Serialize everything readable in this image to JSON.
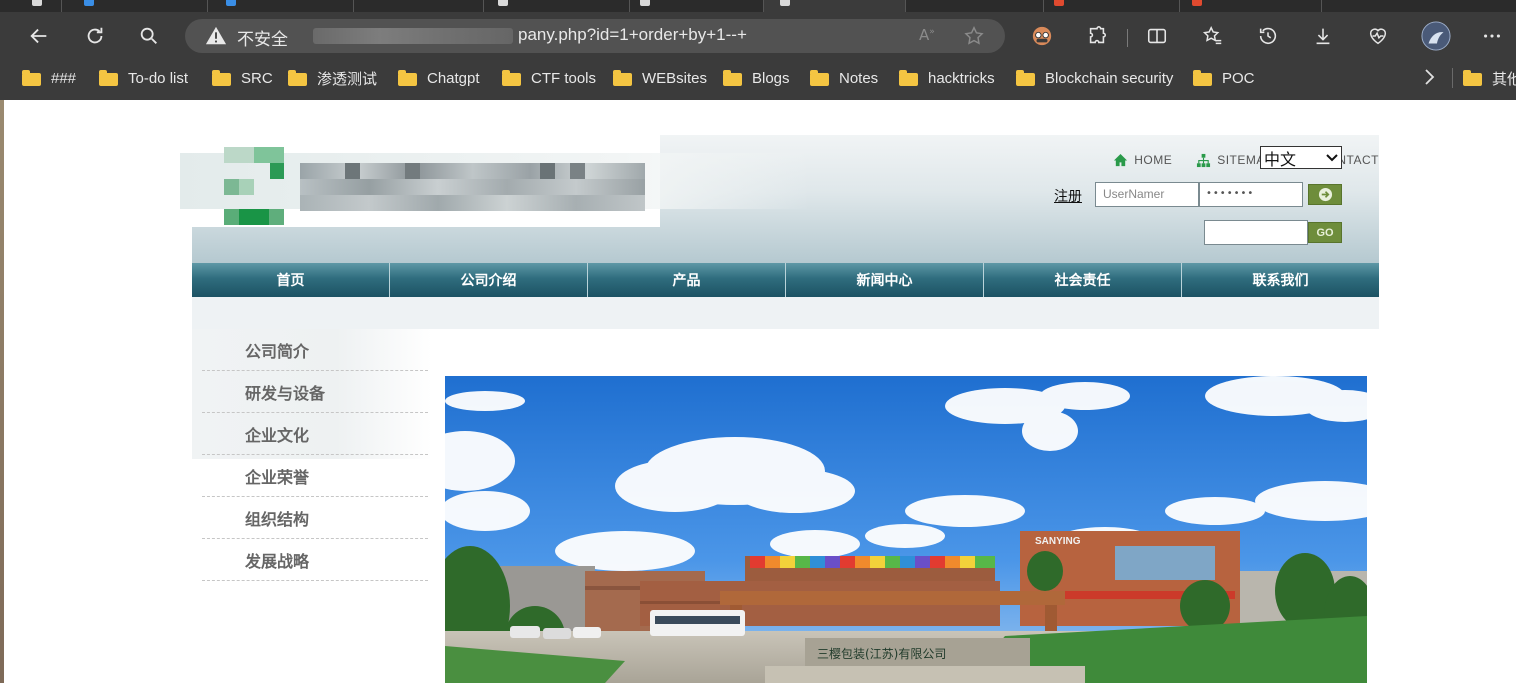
{
  "browser": {
    "address": {
      "security_label": "不安全",
      "url_visible": "pany.php?id=1+order+by+1--+"
    },
    "bookmarks": [
      {
        "label": "###"
      },
      {
        "label": "To-do list"
      },
      {
        "label": "SRC"
      },
      {
        "label": "渗透测试"
      },
      {
        "label": "Chatgpt"
      },
      {
        "label": "CTF tools"
      },
      {
        "label": "WEBsites"
      },
      {
        "label": "Blogs"
      },
      {
        "label": "Notes"
      },
      {
        "label": "hacktricks"
      },
      {
        "label": "Blockchain security"
      },
      {
        "label": "POC"
      },
      {
        "label": "其他"
      }
    ]
  },
  "site": {
    "toplinks": {
      "home": "HOME",
      "sitemap": "SITEMAP",
      "contact": "CONTACT"
    },
    "language": "中文",
    "register": "注册",
    "username_placeholder": "UserNamer",
    "password_mask": "•••••••",
    "go_label": "GO",
    "nav": [
      "首页",
      "公司介绍",
      "产品",
      "新闻中心",
      "社会责任",
      "联系我们"
    ],
    "sidebar": [
      "公司简介",
      "研发与设备",
      "企业文化",
      "企业荣誉",
      "组织结构",
      "发展战略"
    ],
    "banner": {
      "building_sign": "SANYING",
      "gate_sign": "三樱包装(江苏)有限公司"
    }
  },
  "colors": {
    "chrome_bg": "#3b3b3b",
    "nav_teal": "#2f6d7e",
    "button_green": "#6e8d3b",
    "folder_yellow": "#f4c542"
  }
}
